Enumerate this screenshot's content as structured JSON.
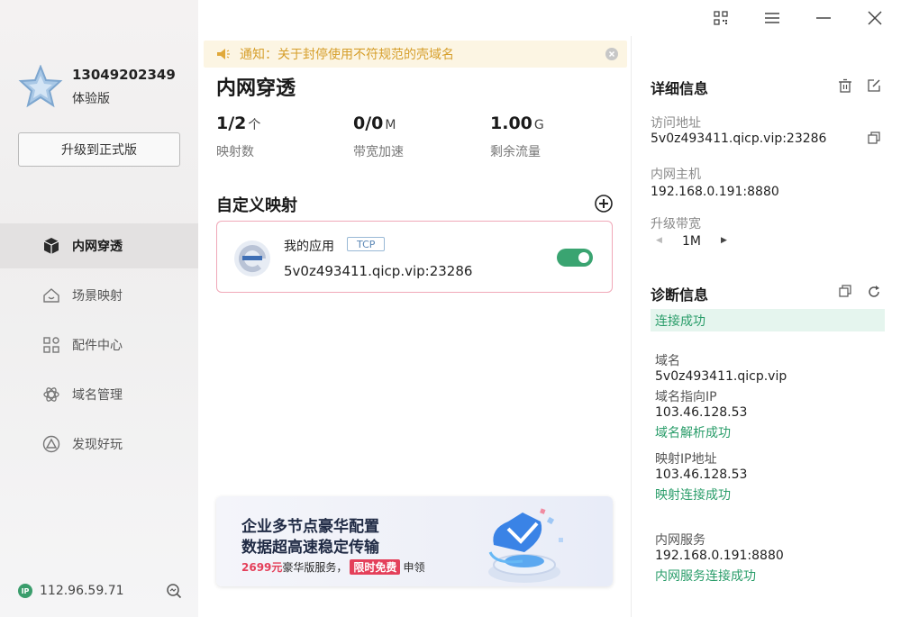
{
  "account": {
    "phone": "13049202349",
    "plan": "体验版",
    "upgrade_label": "升级到正式版"
  },
  "nav": [
    {
      "label": "内网穿透",
      "icon": "cube-icon",
      "active": true
    },
    {
      "label": "场景映射",
      "icon": "house-icon"
    },
    {
      "label": "配件中心",
      "icon": "apps-grid-icon"
    },
    {
      "label": "域名管理",
      "icon": "atom-icon"
    },
    {
      "label": "发现好玩",
      "icon": "triangle-circle-icon"
    }
  ],
  "footer": {
    "ip_badge": "IP",
    "ip": "112.96.59.71"
  },
  "notice": {
    "text": "通知：关于封停使用不符规范的壳域名"
  },
  "main": {
    "title": "内网穿透",
    "stats": [
      {
        "value": "1/2",
        "unit": "个",
        "label": "映射数"
      },
      {
        "value": "0/0",
        "unit": "M",
        "label": "带宽加速"
      },
      {
        "value": "1.00",
        "unit": "G",
        "label": "剩余流量"
      }
    ],
    "section_title": "自定义映射",
    "mapping": {
      "name": "我的应用",
      "protocol": "TCP",
      "address": "5v0z493411.qicp.vip:23286",
      "enabled": true
    }
  },
  "promo": {
    "line1": "企业多节点豪华配置",
    "line2": "数据超高速稳定传输",
    "price": "2699元",
    "text_mid": "豪华版服务，",
    "tag": "限时免费",
    "text_end": "申领"
  },
  "details": {
    "title": "详细信息",
    "access_label": "访问地址",
    "access_value": "5v0z493411.qicp.vip:23286",
    "host_label": "内网主机",
    "host_value": "192.168.0.191:8880",
    "bandwidth_label": "升级带宽",
    "bandwidth_value": "1M"
  },
  "diagnostics": {
    "title": "诊断信息",
    "status": "连接成功",
    "domain_label": "域名",
    "domain_value": "5v0z493411.qicp.vip",
    "domain_ip_label": "域名指向IP",
    "domain_ip_value": "103.46.128.53",
    "domain_ip_ok": "域名解析成功",
    "map_ip_label": "映射IP地址",
    "map_ip_value": "103.46.128.53",
    "map_ip_ok": "映射连接成功",
    "lan_label": "内网服务",
    "lan_value": "192.168.0.191:8880",
    "lan_ok": "内网服务连接成功"
  },
  "colors": {
    "accent_green": "#3aa471",
    "notice_text": "#d69f2c",
    "promo_red": "#e4405a"
  }
}
